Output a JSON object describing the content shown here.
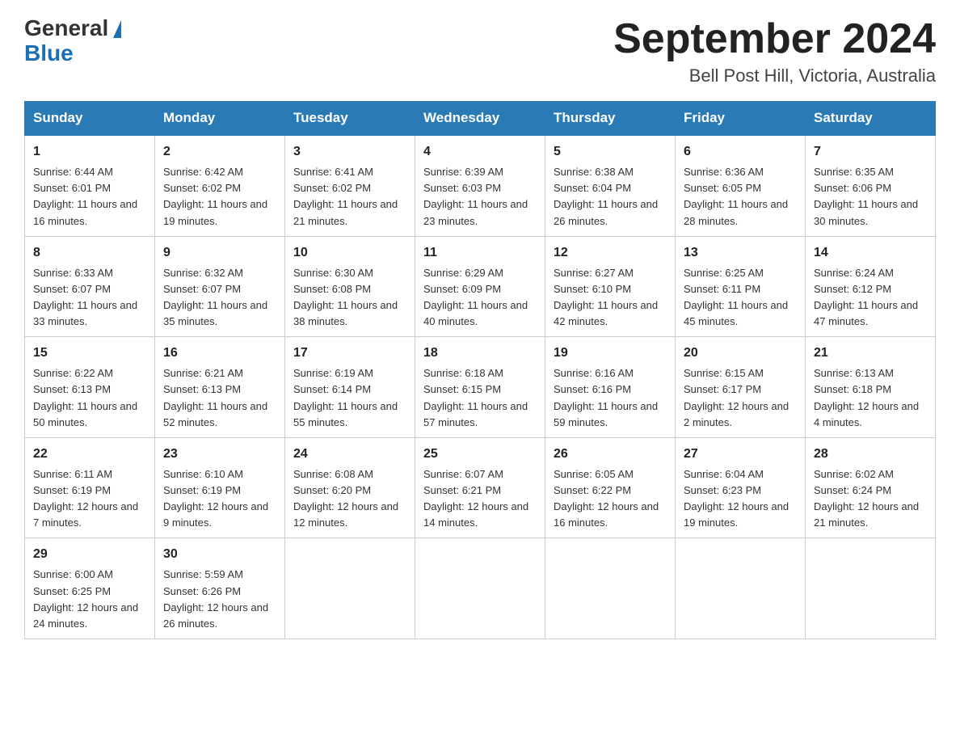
{
  "header": {
    "logo_general": "General",
    "logo_blue": "Blue",
    "month_title": "September 2024",
    "location": "Bell Post Hill, Victoria, Australia"
  },
  "weekdays": [
    "Sunday",
    "Monday",
    "Tuesday",
    "Wednesday",
    "Thursday",
    "Friday",
    "Saturday"
  ],
  "weeks": [
    [
      {
        "day": "1",
        "sunrise": "6:44 AM",
        "sunset": "6:01 PM",
        "daylight": "11 hours and 16 minutes."
      },
      {
        "day": "2",
        "sunrise": "6:42 AM",
        "sunset": "6:02 PM",
        "daylight": "11 hours and 19 minutes."
      },
      {
        "day": "3",
        "sunrise": "6:41 AM",
        "sunset": "6:02 PM",
        "daylight": "11 hours and 21 minutes."
      },
      {
        "day": "4",
        "sunrise": "6:39 AM",
        "sunset": "6:03 PM",
        "daylight": "11 hours and 23 minutes."
      },
      {
        "day": "5",
        "sunrise": "6:38 AM",
        "sunset": "6:04 PM",
        "daylight": "11 hours and 26 minutes."
      },
      {
        "day": "6",
        "sunrise": "6:36 AM",
        "sunset": "6:05 PM",
        "daylight": "11 hours and 28 minutes."
      },
      {
        "day": "7",
        "sunrise": "6:35 AM",
        "sunset": "6:06 PM",
        "daylight": "11 hours and 30 minutes."
      }
    ],
    [
      {
        "day": "8",
        "sunrise": "6:33 AM",
        "sunset": "6:07 PM",
        "daylight": "11 hours and 33 minutes."
      },
      {
        "day": "9",
        "sunrise": "6:32 AM",
        "sunset": "6:07 PM",
        "daylight": "11 hours and 35 minutes."
      },
      {
        "day": "10",
        "sunrise": "6:30 AM",
        "sunset": "6:08 PM",
        "daylight": "11 hours and 38 minutes."
      },
      {
        "day": "11",
        "sunrise": "6:29 AM",
        "sunset": "6:09 PM",
        "daylight": "11 hours and 40 minutes."
      },
      {
        "day": "12",
        "sunrise": "6:27 AM",
        "sunset": "6:10 PM",
        "daylight": "11 hours and 42 minutes."
      },
      {
        "day": "13",
        "sunrise": "6:25 AM",
        "sunset": "6:11 PM",
        "daylight": "11 hours and 45 minutes."
      },
      {
        "day": "14",
        "sunrise": "6:24 AM",
        "sunset": "6:12 PM",
        "daylight": "11 hours and 47 minutes."
      }
    ],
    [
      {
        "day": "15",
        "sunrise": "6:22 AM",
        "sunset": "6:13 PM",
        "daylight": "11 hours and 50 minutes."
      },
      {
        "day": "16",
        "sunrise": "6:21 AM",
        "sunset": "6:13 PM",
        "daylight": "11 hours and 52 minutes."
      },
      {
        "day": "17",
        "sunrise": "6:19 AM",
        "sunset": "6:14 PM",
        "daylight": "11 hours and 55 minutes."
      },
      {
        "day": "18",
        "sunrise": "6:18 AM",
        "sunset": "6:15 PM",
        "daylight": "11 hours and 57 minutes."
      },
      {
        "day": "19",
        "sunrise": "6:16 AM",
        "sunset": "6:16 PM",
        "daylight": "11 hours and 59 minutes."
      },
      {
        "day": "20",
        "sunrise": "6:15 AM",
        "sunset": "6:17 PM",
        "daylight": "12 hours and 2 minutes."
      },
      {
        "day": "21",
        "sunrise": "6:13 AM",
        "sunset": "6:18 PM",
        "daylight": "12 hours and 4 minutes."
      }
    ],
    [
      {
        "day": "22",
        "sunrise": "6:11 AM",
        "sunset": "6:19 PM",
        "daylight": "12 hours and 7 minutes."
      },
      {
        "day": "23",
        "sunrise": "6:10 AM",
        "sunset": "6:19 PM",
        "daylight": "12 hours and 9 minutes."
      },
      {
        "day": "24",
        "sunrise": "6:08 AM",
        "sunset": "6:20 PM",
        "daylight": "12 hours and 12 minutes."
      },
      {
        "day": "25",
        "sunrise": "6:07 AM",
        "sunset": "6:21 PM",
        "daylight": "12 hours and 14 minutes."
      },
      {
        "day": "26",
        "sunrise": "6:05 AM",
        "sunset": "6:22 PM",
        "daylight": "12 hours and 16 minutes."
      },
      {
        "day": "27",
        "sunrise": "6:04 AM",
        "sunset": "6:23 PM",
        "daylight": "12 hours and 19 minutes."
      },
      {
        "day": "28",
        "sunrise": "6:02 AM",
        "sunset": "6:24 PM",
        "daylight": "12 hours and 21 minutes."
      }
    ],
    [
      {
        "day": "29",
        "sunrise": "6:00 AM",
        "sunset": "6:25 PM",
        "daylight": "12 hours and 24 minutes."
      },
      {
        "day": "30",
        "sunrise": "5:59 AM",
        "sunset": "6:26 PM",
        "daylight": "12 hours and 26 minutes."
      },
      null,
      null,
      null,
      null,
      null
    ]
  ],
  "labels": {
    "sunrise": "Sunrise: ",
    "sunset": "Sunset: ",
    "daylight": "Daylight: "
  }
}
